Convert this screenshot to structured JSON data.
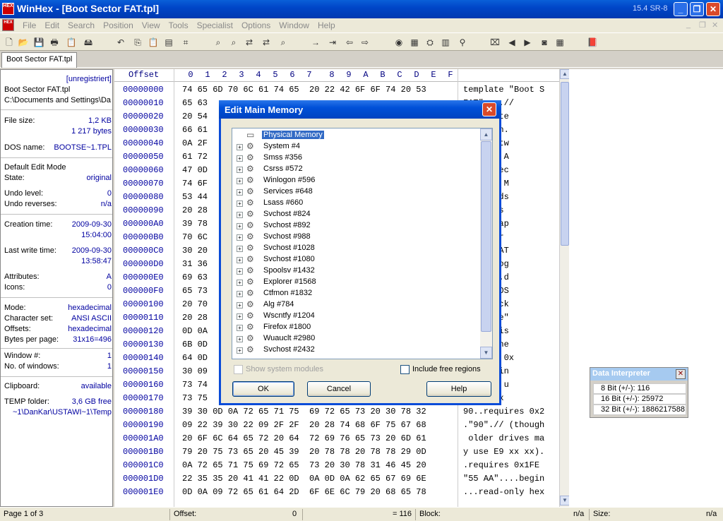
{
  "window": {
    "title": "WinHex - [Boot Sector FAT.tpl]",
    "version": "15.4 SR-8",
    "app_icon_text": "HEX",
    "minimize": "_",
    "restore": "❐",
    "close": "✕"
  },
  "menu": {
    "items": [
      "File",
      "Edit",
      "Search",
      "Position",
      "View",
      "Tools",
      "Specialist",
      "Options",
      "Window",
      "Help"
    ],
    "mdi_min": "_",
    "mdi_restore": "❐",
    "mdi_close": "✕"
  },
  "toolbar": {
    "icons": [
      "new-icon",
      "open-icon",
      "save-icon",
      "print-icon",
      "properties-icon",
      "open-disk-icon",
      "undo-icon",
      "copy-icon",
      "paste-icon",
      "paste-block-icon",
      "write-hex-icon",
      "find-text-icon",
      "find-hex-icon",
      "replace-text-icon",
      "replace-hex-icon",
      "find-next-icon",
      "goto-offset-icon",
      "goto-position-icon",
      "back-icon",
      "forward-icon",
      "disk-editor-icon",
      "ram-editor-icon",
      "disk-tools-icon",
      "calculator-icon",
      "analyze-icon",
      "template-icon",
      "prev-page-icon",
      "next-page-icon",
      "snapshot-icon",
      "grid-icon",
      "help-book-icon"
    ]
  },
  "tab": {
    "label": "Boot Sector FAT.tpl"
  },
  "info": {
    "unregistered": "[unregistriert]",
    "filename": "Boot Sector FAT.tpl",
    "path": "C:\\Documents and Settings\\Da",
    "file_size_label": "File size:",
    "file_size_kb": "1,2 KB",
    "file_size_bytes": "1 217 bytes",
    "dos_name_label": "DOS name:",
    "dos_name": "BOOTSE~1.TPL",
    "edit_mode": "Default Edit Mode",
    "state_label": "State:",
    "state": "original",
    "undo_level_label": "Undo level:",
    "undo_level": "0",
    "undo_reverses_label": "Undo reverses:",
    "undo_reverses": "n/a",
    "creation_label": "Creation time:",
    "creation_date": "2009-09-30",
    "creation_time": "15:04:00",
    "lastwrite_label": "Last write time:",
    "lastwrite_date": "2009-09-30",
    "lastwrite_time": "13:58:47",
    "attributes_label": "Attributes:",
    "attributes": "A",
    "icons_label": "Icons:",
    "icons": "0",
    "mode_label": "Mode:",
    "mode": "hexadecimal",
    "charset_label": "Character set:",
    "charset": "ANSI ASCII",
    "offsets_label": "Offsets:",
    "offsets": "hexadecimal",
    "bpp_label": "Bytes per page:",
    "bpp": "31x16=496",
    "window_no_label": "Window #:",
    "window_no": "1",
    "num_windows_label": "No. of windows:",
    "num_windows": "1",
    "clipboard_label": "Clipboard:",
    "clipboard": "available",
    "temp_label": "TEMP folder:",
    "temp_free": "3,6 GB free",
    "temp_path": "~1\\DanKar\\USTAWI~1\\Temp"
  },
  "hex": {
    "offset_header": "Offset",
    "columns": [
      "0",
      "1",
      "2",
      "3",
      "4",
      "5",
      "6",
      "7",
      "8",
      "9",
      "A",
      "B",
      "C",
      "D",
      "E",
      "F"
    ],
    "rows": [
      {
        "off": "00000000",
        "bytes": "74 65 6D 70 6C 61 74 65  20 22 42 6F 6F 74 20 53",
        "asc": "template \"Boot S"
      },
      {
        "off": "00000010",
        "bytes": "65 63",
        "asc": "FAT\"....//"
      },
      {
        "off": "00000020",
        "bytes": "20 54",
        "asc": "te by Ste"
      },
      {
        "off": "00000030",
        "bytes": "66 61",
        "asc": "ischmann."
      },
      {
        "off": "00000040",
        "bytes": "0A 2F",
        "asc": "ays Softw"
      },
      {
        "off": "00000050",
        "bytes": "61 72",
        "asc": "hnology A"
      },
      {
        "off": "00000060",
        "bytes": "47 0D",
        "asc": " Boot sec"
      },
      {
        "off": "00000070",
        "bytes": "74 6F",
        "asc": "mat for M"
      },
      {
        "off": "00000080",
        "bytes": "53 44",
        "asc": "0 onwards"
      },
      {
        "off": "00000090",
        "bytes": "20 28",
        "asc": " Windows "
      },
      {
        "off": "000000A0",
        "bytes": "39 78",
        "asc": " To be ap"
      },
      {
        "off": "000000B0",
        "bytes": "70 6C",
        "asc": "o sector "
      },
      {
        "off": "000000C0",
        "bytes": "30 20",
        "asc": "FAT12/FAT"
      },
      {
        "off": "000000D0",
        "bytes": "31 36",
        "asc": "atted log"
      },
      {
        "off": "000000E0",
        "bytes": "69 63",
        "asc": "ive.....d"
      },
      {
        "off": "000000F0",
        "bytes": "65 73",
        "asc": "ion \"BIOS"
      },
      {
        "off": "00000100",
        "bytes": "20 70",
        "asc": "ter block"
      },
      {
        "off": "00000110",
        "bytes": "20 28",
        "asc": "and more\""
      },
      {
        "off": "00000120",
        "bytes": "0D 0A",
        "asc": "es_to dis"
      },
      {
        "off": "00000130",
        "bytes": "6B 0D",
        "asc": "or-aligne"
      },
      {
        "off": "00000140",
        "bytes": "64 0D",
        "asc": "equires 0x"
      },
      {
        "off": "00000150",
        "bytes": "30 09",
        "asc": "// JMP in"
      },
      {
        "off": "00000160",
        "bytes": "73 74",
        "asc": "on will u"
      },
      {
        "off": "00000170",
        "bytes": "73 75",
        "asc": "be EB xx "
      },
      {
        "off": "00000180",
        "bytes": "39 30 0D 0A 72 65 71 75  69 72 65 73 20 30 78 32",
        "asc": "90..requires 0x2"
      },
      {
        "off": "00000190",
        "bytes": "09 22 39 30 22 09 2F 2F  20 28 74 68 6F 75 67 68",
        "asc": ".\"90\".// (though"
      },
      {
        "off": "000001A0",
        "bytes": "20 6F 6C 64 65 72 20 64  72 69 76 65 73 20 6D 61",
        "asc": " older drives ma"
      },
      {
        "off": "000001B0",
        "bytes": "79 20 75 73 65 20 45 39  20 78 78 20 78 78 29 0D",
        "asc": "y use E9 xx xx)."
      },
      {
        "off": "000001C0",
        "bytes": "0A 72 65 71 75 69 72 65  73 20 30 78 31 46 45 20",
        "asc": ".requires 0x1FE "
      },
      {
        "off": "000001D0",
        "bytes": "22 35 35 20 41 41 22 0D  0A 0D 0A 62 65 67 69 6E",
        "asc": "\"55 AA\"....begin"
      },
      {
        "off": "000001E0",
        "bytes": "0D 0A 09 72 65 61 64 2D  6F 6E 6C 79 20 68 65 78",
        "asc": "...read-only hex"
      }
    ]
  },
  "dialog": {
    "title": "Edit Main Memory",
    "close": "✕",
    "tree": [
      {
        "label": "Physical Memory",
        "expander": "",
        "icon": "memory-chip-icon",
        "selected": true
      },
      {
        "label": "System #4",
        "expander": "+",
        "icon": "process-icon"
      },
      {
        "label": "Smss #356",
        "expander": "+",
        "icon": "process-icon"
      },
      {
        "label": "Csrss #572",
        "expander": "+",
        "icon": "process-icon"
      },
      {
        "label": "Winlogon #596",
        "expander": "+",
        "icon": "process-icon"
      },
      {
        "label": "Services #648",
        "expander": "+",
        "icon": "process-icon"
      },
      {
        "label": "Lsass #660",
        "expander": "+",
        "icon": "process-icon"
      },
      {
        "label": "Svchost #824",
        "expander": "+",
        "icon": "process-icon"
      },
      {
        "label": "Svchost #892",
        "expander": "+",
        "icon": "process-icon"
      },
      {
        "label": "Svchost #988",
        "expander": "+",
        "icon": "process-icon"
      },
      {
        "label": "Svchost #1028",
        "expander": "+",
        "icon": "process-icon"
      },
      {
        "label": "Svchost #1080",
        "expander": "+",
        "icon": "process-icon"
      },
      {
        "label": "Spoolsv #1432",
        "expander": "+",
        "icon": "process-icon"
      },
      {
        "label": "Explorer #1568",
        "expander": "+",
        "icon": "process-icon"
      },
      {
        "label": "Ctfmon #1832",
        "expander": "+",
        "icon": "process-icon"
      },
      {
        "label": "Alg #784",
        "expander": "+",
        "icon": "process-icon"
      },
      {
        "label": "Wscntfy #1204",
        "expander": "+",
        "icon": "process-icon"
      },
      {
        "label": "Firefox #1800",
        "expander": "+",
        "icon": "process-icon"
      },
      {
        "label": "Wuauclt #2980",
        "expander": "+",
        "icon": "process-icon"
      },
      {
        "label": "Svchost #2432",
        "expander": "+",
        "icon": "process-icon"
      }
    ],
    "show_system_modules": "Show system modules",
    "include_free_regions": "Include free regions",
    "ok": "OK",
    "cancel": "Cancel",
    "help": "Help"
  },
  "data_interpreter": {
    "title": "Data Interpreter",
    "close": "✕",
    "rows": [
      "8 Bit (+/-): 116",
      "16 Bit (+/-): 25972",
      "32 Bit (+/-): 1886217588"
    ]
  },
  "status": {
    "page": "Page 1 of 3",
    "offset_label": "Offset:",
    "offset_value": "0",
    "eq_value": "= 116",
    "block_label": "Block:",
    "block_value": "n/a",
    "size_label": "Size:",
    "size_value": "n/a"
  },
  "colors": {
    "title_blue": "#0046c8",
    "selection": "#316ac5",
    "offset_text": "#0000a0"
  }
}
